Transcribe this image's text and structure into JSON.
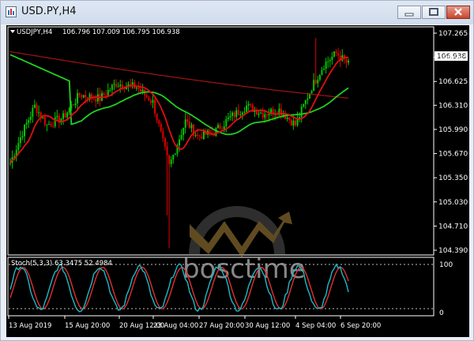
{
  "window": {
    "title": "USD.PY,H4"
  },
  "chart_data": {
    "type": "candlestick",
    "symbol_label": "USDJPY,H4",
    "ohlc_readout": "106.796 107.009 106.795 106.938",
    "current_price": "106.938",
    "price_axis_ticks": [
      "107.265",
      "106.945",
      "106.625",
      "106.310",
      "105.990",
      "105.670",
      "105.350",
      "105.030",
      "104.710",
      "104.390"
    ],
    "price_range": [
      104.39,
      107.265
    ],
    "time_axis_ticks": [
      "13 Aug 2019",
      "15 Aug 20:00",
      "20 Aug 12:00",
      "23 Aug 04:00",
      "27 Aug 20:00",
      "30 Aug 12:00",
      "4 Sep 04:00",
      "6 Sep 20:00"
    ],
    "indicator_label": "Stoch(5,3,3) 63.3475 52.4984",
    "indicator_ticks": [
      "100",
      "0"
    ],
    "indicator_range": [
      0,
      100
    ],
    "colors": {
      "bull": "#00c800",
      "bear": "#e00000",
      "ma_fast": "#e01010",
      "ma_slow": "#20d020",
      "ma_long": "#a01515",
      "stoch_main": "#1fb8c8",
      "stoch_signal": "#e03030",
      "grid": "#ffffff"
    }
  },
  "watermark": {
    "text": "bosctime"
  }
}
